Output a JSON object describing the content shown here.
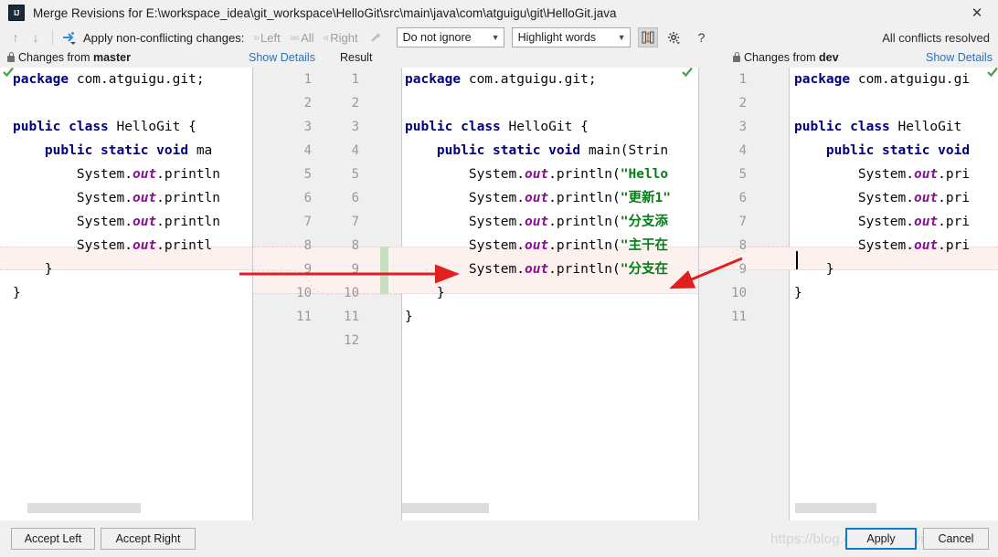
{
  "window": {
    "title": "Merge Revisions for E:\\workspace_idea\\git_workspace\\HelloGit\\src\\main\\java\\com\\atguigu\\git\\HelloGit.java",
    "app_icon": "intellij-idea-icon",
    "close_label": "✕"
  },
  "toolbar": {
    "prev_icon": "arrow-up-icon",
    "next_icon": "arrow-down-icon",
    "magic_icon": "apply-non-conflicting-icon",
    "apply_label": "Apply non-conflicting changes:",
    "left_label": "Left",
    "all_label": "All",
    "right_label": "Right",
    "wand_icon": "magic-wand-icon",
    "ignore_value": "Do not ignore",
    "highlight_value": "Highlight words",
    "collapse_icon": "collapse-unchanged-icon",
    "settings_icon": "gear-icon",
    "help_icon": "?",
    "status": "All conflicts resolved"
  },
  "headers": {
    "left_lock_icon": "lock-icon",
    "left_title_prefix": "Changes from ",
    "left_branch": "master",
    "left_show_details": "Show Details",
    "result_label": "Result",
    "right_lock_icon": "lock-icon",
    "right_title_prefix": "Changes from ",
    "right_branch": "dev",
    "right_show_details": "Show Details"
  },
  "panes": {
    "left": {
      "name": "master",
      "lines": [
        "package com.atguigu.git;",
        "",
        "public class HelloGit {",
        "    public static void ma",
        "        System.out.println",
        "        System.out.println",
        "        System.out.println",
        "        System.out.printl",
        "    }",
        "}"
      ]
    },
    "center": {
      "name": "Result",
      "line_numbers_a": [
        "1",
        "2",
        "3",
        "4",
        "5",
        "6",
        "7",
        "8",
        "9",
        "10",
        "11"
      ],
      "line_numbers_b": [
        "1",
        "2",
        "3",
        "4",
        "5",
        "6",
        "7",
        "8",
        "9",
        "10",
        "11",
        "12"
      ],
      "lines": [
        "package com.atguigu.git;",
        "",
        "public class HelloGit {",
        "    public static void main(Strin",
        "        System.out.println(\"Hello",
        "        System.out.println(\"更新1\"",
        "        System.out.println(\"分支添",
        "        System.out.println(\"主干在",
        "        System.out.println(\"分支在",
        "    }",
        "}"
      ]
    },
    "right": {
      "name": "dev",
      "line_numbers": [
        "1",
        "2",
        "3",
        "4",
        "5",
        "6",
        "7",
        "8",
        "9",
        "10",
        "11"
      ],
      "lines": [
        "package com.atguigu.gi",
        "",
        "public class HelloGit ",
        "    public static void",
        "        System.out.pri",
        "        System.out.pri",
        "        System.out.pri",
        "        System.out.pri",
        "    }",
        "}"
      ]
    }
  },
  "buttons": {
    "accept_left": "Accept Left",
    "accept_right": "Accept Right",
    "apply": "Apply",
    "cancel": "Cancel"
  },
  "watermark": "https://blog.csdn.net/Alvin9965",
  "colors": {
    "keyword": "#000080",
    "string": "#067d17",
    "field": "#871094",
    "link": "#2f6fb5",
    "accent": "#0b7ecb",
    "change_band": "#fdf1f0",
    "change_marker": "#c6dfc0",
    "annotation": "#e02020"
  }
}
